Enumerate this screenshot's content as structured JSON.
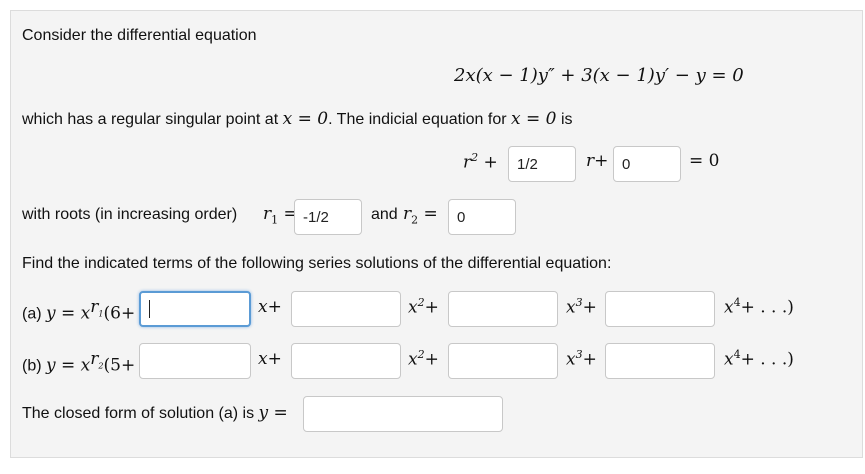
{
  "intro": "Consider the differential equation",
  "equation": "2x(x − 1)y″ + 3(x − 1)y′ − y = 0",
  "singular_text": "which has a regular singular point at",
  "singular_eq": "x = 0",
  "indicial_text": ". The indicial equation for",
  "indicial_at": "x = 0",
  "indicial_is": "is",
  "indicial": {
    "r_sq": "r",
    "exp2": "2",
    "plus": "+",
    "coef1_value": "1/2",
    "r_plus": "r+",
    "coef2_value": "0",
    "equals_zero": "= 0"
  },
  "roots": {
    "text": "with roots (in increasing order)",
    "r1_label": "r",
    "r1_sub": "1",
    "eq": "=",
    "r1_value": "-1/2",
    "and": "and",
    "r2_label": "r",
    "r2_sub": "2",
    "eq2": "=",
    "r2_value": "0"
  },
  "find_text": "Find the indicated terms of the following series solutions of the differential equation:",
  "part_a": {
    "label": "(a)",
    "y_eq": "y = x",
    "sup_r": "r",
    "sup_sub": "1",
    "lead": "(6+",
    "term_x": "x+",
    "term_x2": "x",
    "term_x3": "x",
    "term_x4": "x",
    "plus": "+",
    "tail": "+ . . .)",
    "values": [
      "",
      "",
      "",
      ""
    ]
  },
  "part_b": {
    "label": "(b)",
    "y_eq": "y = x",
    "sup_r": "r",
    "sup_sub": "2",
    "lead": "(5+",
    "term_x": "x+",
    "term_x2": "x",
    "term_x3": "x",
    "term_x4": "x",
    "plus": "+",
    "tail": "+ . . .)",
    "values": [
      "",
      "",
      "",
      ""
    ]
  },
  "exp": {
    "two": "2",
    "three": "3",
    "four": "4"
  },
  "closed_form": {
    "text": "The closed form of solution (a) is",
    "y_eq": "y =",
    "value": ""
  }
}
